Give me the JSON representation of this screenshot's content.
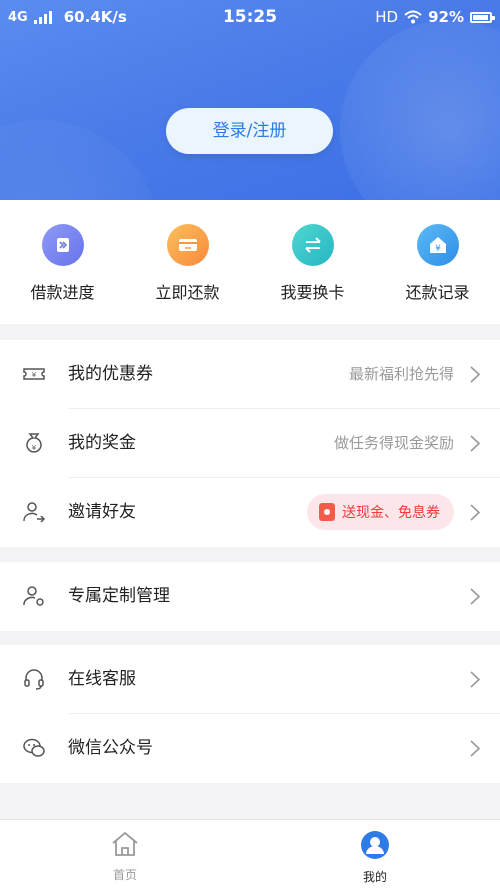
{
  "status_bar": {
    "network": "4G",
    "speed": "60.4K/s",
    "time": "15:25",
    "hd": "HD",
    "battery": "92%",
    "battery_level": 0.92
  },
  "header": {
    "login_label": "登录/注册"
  },
  "quick_actions": [
    {
      "label": "借款进度",
      "icon": "progress-icon",
      "color": "#7b86f0"
    },
    {
      "label": "立即还款",
      "icon": "card-repay-icon",
      "color": "#f9a24a"
    },
    {
      "label": "我要换卡",
      "icon": "swap-card-icon",
      "color": "#33c6c8"
    },
    {
      "label": "还款记录",
      "icon": "home-yen-icon",
      "color": "#48a8f0"
    }
  ],
  "menu_group1": [
    {
      "title": "我的优惠券",
      "hint": "最新福利抢先得",
      "icon": "coupon-icon"
    },
    {
      "title": "我的奖金",
      "hint": "做任务得现金奖励",
      "icon": "money-bag-icon"
    },
    {
      "title": "邀请好友",
      "badge": "送现金、免息券",
      "icon": "invite-user-icon"
    }
  ],
  "menu_group2": [
    {
      "title": "专属定制管理",
      "icon": "user-settings-icon"
    }
  ],
  "menu_group3": [
    {
      "title": "在线客服",
      "icon": "headset-icon"
    },
    {
      "title": "微信公众号",
      "icon": "wechat-icon"
    }
  ],
  "tabbar": {
    "home_label": "首页",
    "me_label": "我的",
    "active_color": "#2f7be6",
    "inactive_color": "#9a9a9a"
  }
}
